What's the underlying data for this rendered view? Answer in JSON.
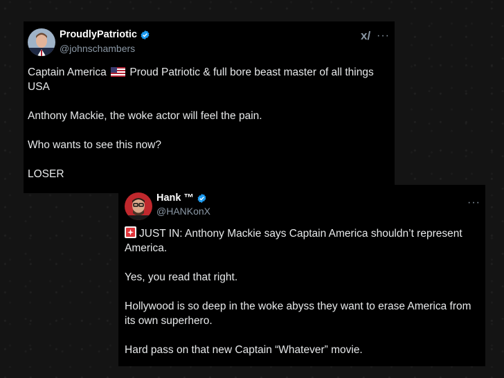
{
  "tweet1": {
    "display_name": "ProudlyPatriotic",
    "handle": "@johnschambers",
    "line1_pre": "Captain America",
    "line1_post": "Proud Patriotic & full bore beast master of all things",
    "line1_cont": "USA",
    "para2": "Anthony Mackie, the woke actor will feel the pain.",
    "para3": "Who wants to see this now?",
    "para4": "LOSER",
    "more_label": "···",
    "grok_label": "x/"
  },
  "tweet2": {
    "display_name": "Hank ™",
    "handle": "@HANKonX",
    "para1_line1": "JUST IN: Anthony Mackie says Captain America shouldn’t represent",
    "para1_line2": "America.",
    "para2": "Yes, you read that right.",
    "para3_line1": "Hollywood is so deep in the woke abyss they want to erase America from",
    "para3_line2": "its own superhero.",
    "para4": "Hard pass on that new Captain “Whatever” movie.",
    "more_label": "···"
  },
  "colors": {
    "verified": "#1d9bf0",
    "text": "#e7e9ea",
    "secondary": "#8b98a5",
    "card": "#000000"
  }
}
